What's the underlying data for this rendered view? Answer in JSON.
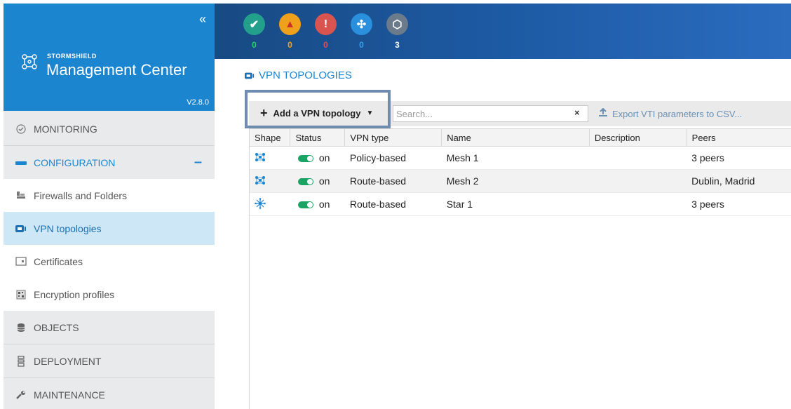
{
  "app": {
    "brand_small": "STORMSHIELD",
    "brand_big": "Management Center",
    "version": "V2.8.0",
    "collapse_icon": "«"
  },
  "status_counts": [
    {
      "icon": "check-icon",
      "glyph": "✔",
      "color": "#23a08c",
      "count": "0",
      "count_color": "#2ecc71"
    },
    {
      "icon": "warning-icon",
      "glyph": "▲",
      "color": "#f0a11c",
      "count": "0",
      "count_color": "#f0a11c"
    },
    {
      "icon": "error-icon",
      "glyph": "!",
      "color": "#d9534f",
      "count": "0",
      "count_color": "#d9534f"
    },
    {
      "icon": "network-icon",
      "glyph": "✣",
      "color": "#2a8fdc",
      "count": "0",
      "count_color": "#3ba0ee"
    },
    {
      "icon": "cube-icon",
      "glyph": "⬡",
      "color": "#6b7b8c",
      "count": "3",
      "count_color": "#ffffff"
    }
  ],
  "sidebar": {
    "monitoring": "MONITORING",
    "configuration": "CONFIGURATION",
    "config_toggle": "–",
    "items": [
      {
        "label": "Firewalls and Folders",
        "icon": "firewall-icon"
      },
      {
        "label": "VPN topologies",
        "icon": "vpn-icon"
      },
      {
        "label": "Certificates",
        "icon": "certificate-icon"
      },
      {
        "label": "Encryption profiles",
        "icon": "encryption-icon"
      }
    ],
    "objects": "OBJECTS",
    "deployment": "DEPLOYMENT",
    "maintenance": "MAINTENANCE"
  },
  "page": {
    "title": "VPN TOPOLOGIES"
  },
  "toolbar": {
    "add_label": "Add a VPN topology",
    "search_placeholder": "Search...",
    "clear": "×",
    "export_label": "Export VTI parameters to CSV..."
  },
  "table": {
    "headers": [
      "Shape",
      "Status",
      "VPN type",
      "Name",
      "Description",
      "Peers"
    ],
    "rows": [
      {
        "shape": "mesh-icon",
        "status": "on",
        "vpn_type": "Policy-based",
        "name": "Mesh 1",
        "description": "",
        "peers": "3 peers"
      },
      {
        "shape": "mesh-icon",
        "status": "on",
        "vpn_type": "Route-based",
        "name": "Mesh 2",
        "description": "",
        "peers": "Dublin, Madrid"
      },
      {
        "shape": "star-icon",
        "status": "on",
        "vpn_type": "Route-based",
        "name": "Star 1",
        "description": "",
        "peers": "3 peers"
      }
    ]
  }
}
